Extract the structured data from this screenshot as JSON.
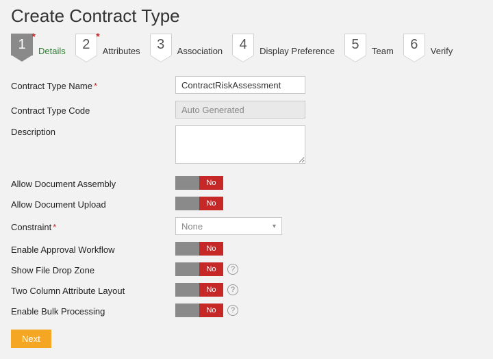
{
  "page": {
    "title": "Create Contract Type"
  },
  "wizard": {
    "steps": [
      {
        "num": "1",
        "label": "Details",
        "required": true,
        "active": true
      },
      {
        "num": "2",
        "label": "Attributes",
        "required": true,
        "active": false
      },
      {
        "num": "3",
        "label": "Association",
        "required": false,
        "active": false
      },
      {
        "num": "4",
        "label": "Display Preference",
        "required": false,
        "active": false
      },
      {
        "num": "5",
        "label": "Team",
        "required": false,
        "active": false
      },
      {
        "num": "6",
        "label": "Verify",
        "required": false,
        "active": false
      }
    ]
  },
  "fields": {
    "name": {
      "label": "Contract Type Name",
      "required": true,
      "value": "ContractRiskAssessment"
    },
    "code": {
      "label": "Contract Type Code",
      "required": false,
      "placeholder": "Auto Generated",
      "value": ""
    },
    "description": {
      "label": "Description",
      "required": false,
      "value": ""
    },
    "constraint": {
      "label": "Constraint",
      "required": true,
      "value": "None"
    }
  },
  "toggles": {
    "allowAssembly": {
      "label": "Allow Document Assembly",
      "value": "No",
      "help": false
    },
    "allowUpload": {
      "label": "Allow Document Upload",
      "value": "No",
      "help": false
    },
    "approval": {
      "label": "Enable Approval Workflow",
      "value": "No",
      "help": false
    },
    "dropZone": {
      "label": "Show File Drop Zone",
      "value": "No",
      "help": true
    },
    "twoCol": {
      "label": "Two Column Attribute Layout",
      "value": "No",
      "help": true
    },
    "bulk": {
      "label": "Enable Bulk Processing",
      "value": "No",
      "help": true
    }
  },
  "labels": {
    "next": "Next",
    "requiredMark": "*",
    "helpGlyph": "?"
  }
}
